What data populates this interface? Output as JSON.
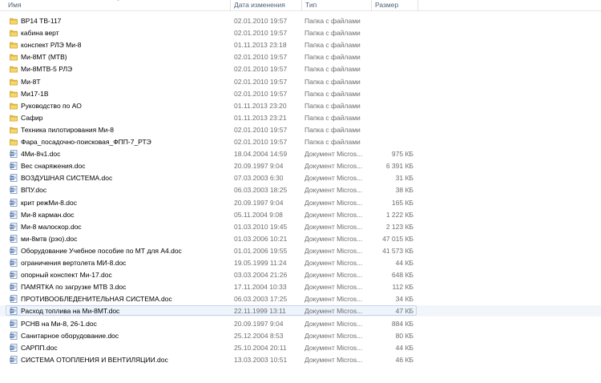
{
  "columns": {
    "name": "Имя",
    "date": "Дата изменения",
    "type": "Тип",
    "size": "Размер"
  },
  "files": [
    {
      "icon": "folder-icon",
      "name": "ВР14 ТВ-117",
      "date": "02.01.2010 19:57",
      "type": "Папка с файлами",
      "size": ""
    },
    {
      "icon": "folder-icon",
      "name": "кабина верт",
      "date": "02.01.2010 19:57",
      "type": "Папка с файлами",
      "size": ""
    },
    {
      "icon": "folder-icon",
      "name": "конспект РЛЭ Ми-8",
      "date": "01.11.2013 23:18",
      "type": "Папка с файлами",
      "size": ""
    },
    {
      "icon": "folder-icon",
      "name": "Ми-8МТ (МТВ)",
      "date": "02.01.2010 19:57",
      "type": "Папка с файлами",
      "size": ""
    },
    {
      "icon": "folder-icon",
      "name": "Ми-8МТВ-5 РЛЭ",
      "date": "02.01.2010 19:57",
      "type": "Папка с файлами",
      "size": ""
    },
    {
      "icon": "folder-icon",
      "name": "Ми-8Т",
      "date": "02.01.2010 19:57",
      "type": "Папка с файлами",
      "size": ""
    },
    {
      "icon": "folder-icon",
      "name": "Ми17-1В",
      "date": "02.01.2010 19:57",
      "type": "Папка с файлами",
      "size": ""
    },
    {
      "icon": "folder-icon",
      "name": "Руководство по АО",
      "date": "01.11.2013 23:20",
      "type": "Папка с файлами",
      "size": ""
    },
    {
      "icon": "folder-icon",
      "name": "Сафир",
      "date": "01.11.2013 23:21",
      "type": "Папка с файлами",
      "size": ""
    },
    {
      "icon": "folder-icon",
      "name": "Техника пилотирования Ми-8",
      "date": "02.01.2010 19:57",
      "type": "Папка с файлами",
      "size": ""
    },
    {
      "icon": "folder-icon",
      "name": "Фара_посадочно-поисковая_ФПП-7_РТЭ",
      "date": "02.01.2010 19:57",
      "type": "Папка с файлами",
      "size": ""
    },
    {
      "icon": "word-document-icon",
      "name": "4Ми-8ч1.doc",
      "date": "18.04.2004 14:59",
      "type": "Документ Micros...",
      "size": "975 КБ"
    },
    {
      "icon": "word-document-icon",
      "name": "Вес снаряжения.doc",
      "date": "20.09.1997 9:04",
      "type": "Документ Micros...",
      "size": "6 391 КБ"
    },
    {
      "icon": "word-document-icon",
      "name": "ВОЗДУШНАЯ СИСТЕМА.doc",
      "date": "07.03.2003 6:30",
      "type": "Документ Micros...",
      "size": "31 КБ"
    },
    {
      "icon": "word-document-icon",
      "name": "ВПУ.doc",
      "date": "06.03.2003 18:25",
      "type": "Документ Micros...",
      "size": "38 КБ"
    },
    {
      "icon": "word-document-icon",
      "name": "крит режМи-8.doc",
      "date": "20.09.1997 9:04",
      "type": "Документ Micros...",
      "size": "165 КБ"
    },
    {
      "icon": "word-document-icon",
      "name": "Ми-8 карман.doc",
      "date": "05.11.2004 9:08",
      "type": "Документ Micros...",
      "size": "1 222 КБ"
    },
    {
      "icon": "word-document-icon",
      "name": "Ми-8 малоскор.doc",
      "date": "01.03.2010 19:45",
      "type": "Документ Micros...",
      "size": "2 123 КБ"
    },
    {
      "icon": "word-document-icon",
      "name": "ми-8мтв (рэо).doc",
      "date": "01.03.2006 10:21",
      "type": "Документ Micros...",
      "size": "47 015 КБ"
    },
    {
      "icon": "word-document-icon",
      "name": "Оборудование Учебное пособие по МТ для А4.doc",
      "date": "01.01.2006 19:55",
      "type": "Документ Micros...",
      "size": "41 573 КБ"
    },
    {
      "icon": "word-document-icon",
      "name": "ограничения вертолета МИ-8.doc",
      "date": "19.05.1999 11:24",
      "type": "Документ Micros...",
      "size": "44 КБ"
    },
    {
      "icon": "word-document-icon",
      "name": "опорный конспект Ми-17.doc",
      "date": "03.03.2004 21:26",
      "type": "Документ Micros...",
      "size": "648 КБ"
    },
    {
      "icon": "word-document-icon",
      "name": "ПАМЯТКА по загрузке МТВ 3.doc",
      "date": "17.11.2004 10:33",
      "type": "Документ Micros...",
      "size": "112 КБ"
    },
    {
      "icon": "word-document-icon",
      "name": "ПРОТИВООБЛЕДЕНИТЕЛЬНАЯ СИСТЕМА.doc",
      "date": "06.03.2003 17:25",
      "type": "Документ Micros...",
      "size": "34 КБ"
    },
    {
      "icon": "word-document-icon",
      "name": "Расход топлива на Ми-8МТ.doc",
      "date": "22.11.1999 13:11",
      "type": "Документ Micros...",
      "size": "47 КБ",
      "selected": true
    },
    {
      "icon": "word-document-icon",
      "name": "РСНВ на Ми-8, 26-1.doc",
      "date": "20.09.1997 9:04",
      "type": "Документ Micros...",
      "size": "884 КБ"
    },
    {
      "icon": "word-document-icon",
      "name": "Санитарное оборудование.doc",
      "date": "25.12.2004 8:53",
      "type": "Документ Micros...",
      "size": "80 КБ"
    },
    {
      "icon": "word-document-icon",
      "name": "САРПП.doc",
      "date": "25.10.2004 20:11",
      "type": "Документ Micros...",
      "size": "44 КБ"
    },
    {
      "icon": "word-document-icon",
      "name": "СИСТЕМА ОТОПЛЕНИЯ И ВЕНТИЛЯЦИИ.doc",
      "date": "13.03.2003 10:51",
      "type": "Документ Micros...",
      "size": "46 КБ"
    }
  ]
}
